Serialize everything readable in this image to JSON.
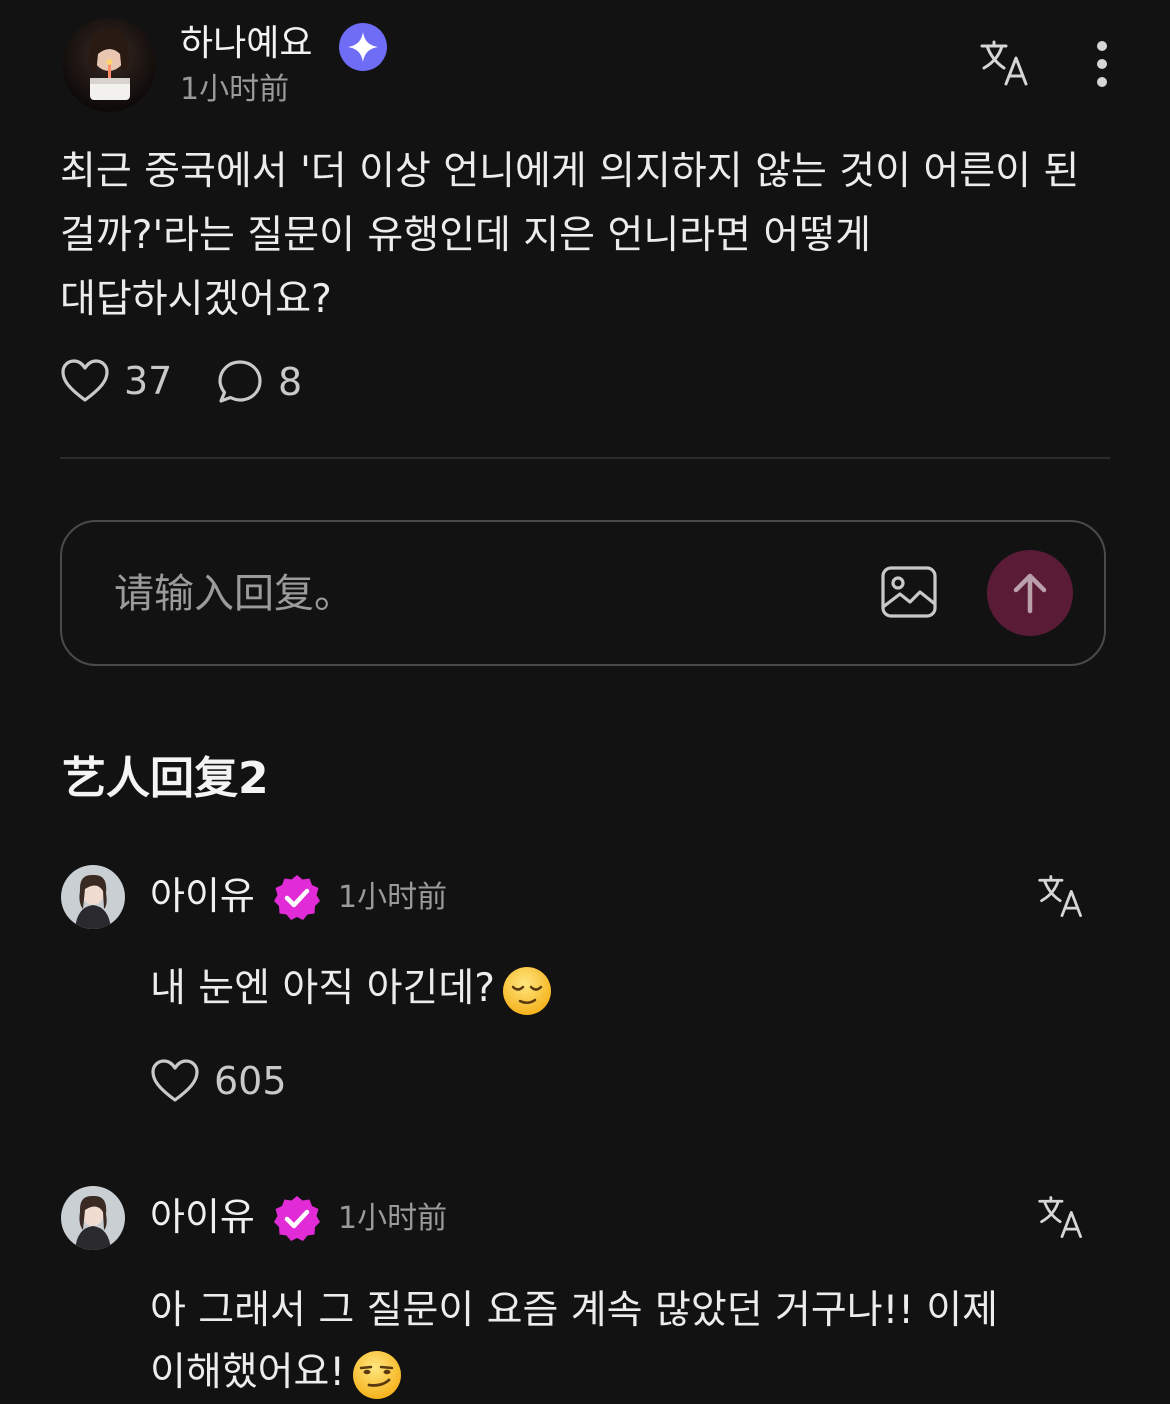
{
  "post": {
    "author": "하나예요",
    "time": "1小时前",
    "body": "최근 중국에서 '더 이상 언니에게 의지하지 않는 것이 어른이 된 걸까?'라는 질문이 유행인데 지은 언니라면 어떻게 대답하시겠어요?",
    "likes": "37",
    "comments": "8"
  },
  "reply": {
    "placeholder": "请输入回复。"
  },
  "section": {
    "title": "艺人回复2"
  },
  "artist_replies": [
    {
      "name": "아이유",
      "time": "1小时前",
      "text": "내 눈엔 아직 아긴데?",
      "emoji": "relieved-face",
      "likes": "605"
    },
    {
      "name": "아이유",
      "time": "1小时前",
      "text": "아 그래서 그 질문이 요즘 계속 많았던 거구나!! 이제 이해했어요!",
      "emoji": "smirking-face"
    }
  ],
  "colors": {
    "background": "#121212",
    "verified_badge": "#e12bd6",
    "sparkle_badge": "#6f6cf5",
    "send_button": "#5a1b37"
  }
}
